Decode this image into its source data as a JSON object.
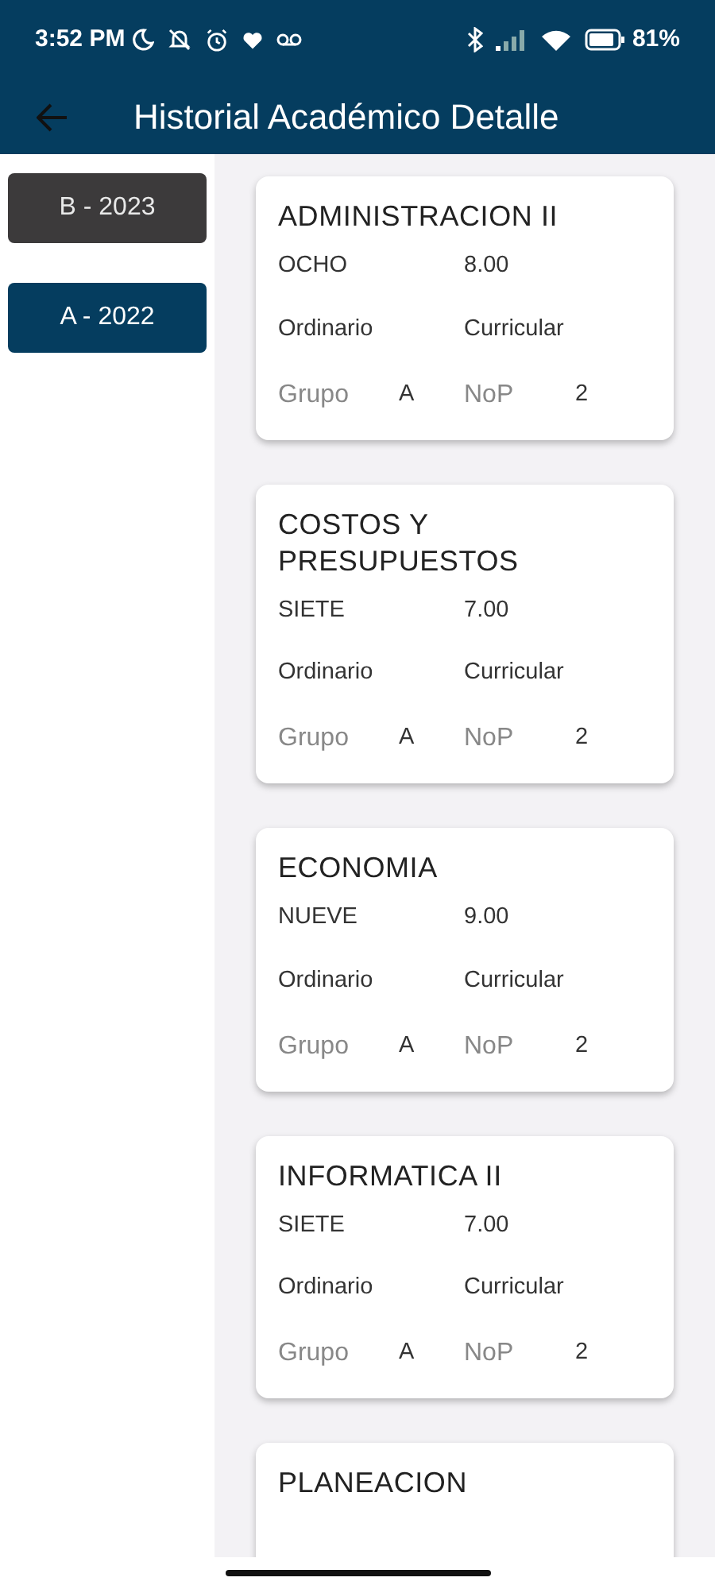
{
  "status_bar": {
    "time": "3:52 PM",
    "battery": "81%"
  },
  "app_bar": {
    "title": "Historial Académico Detalle"
  },
  "periods": [
    {
      "label": "B - 2023",
      "selected": false
    },
    {
      "label": "A - 2022",
      "selected": true
    }
  ],
  "courses": [
    {
      "title": "ADMINISTRACION II",
      "grade_word": "OCHO",
      "grade": "8.00",
      "exam_type": "Ordinario",
      "category": "Curricular",
      "group_label": "Grupo",
      "group": "A",
      "nop_label": "NoP",
      "nop": "2"
    },
    {
      "title": "COSTOS Y PRESUPUESTOS",
      "grade_word": "SIETE",
      "grade": "7.00",
      "exam_type": "Ordinario",
      "category": "Curricular",
      "group_label": "Grupo",
      "group": "A",
      "nop_label": "NoP",
      "nop": "2"
    },
    {
      "title": "ECONOMIA",
      "grade_word": "NUEVE",
      "grade": "9.00",
      "exam_type": "Ordinario",
      "category": "Curricular",
      "group_label": "Grupo",
      "group": "A",
      "nop_label": "NoP",
      "nop": "2"
    },
    {
      "title": "INFORMATICA II",
      "grade_word": "SIETE",
      "grade": "7.00",
      "exam_type": "Ordinario",
      "category": "Curricular",
      "group_label": "Grupo",
      "group": "A",
      "nop_label": "NoP",
      "nop": "2"
    },
    {
      "title": "PLANEACION"
    }
  ]
}
